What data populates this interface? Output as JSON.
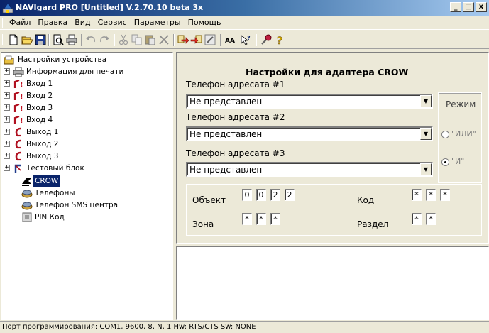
{
  "window": {
    "title": "NAVIgard PRO [Untitled]  V.2.70.10 beta 3x",
    "minimize": "_",
    "maximize": "□",
    "close": "x"
  },
  "menu": [
    "Файл",
    "Правка",
    "Вид",
    "Сервис",
    "Параметры",
    "Помощь"
  ],
  "toolbar_icons": [
    "new-icon",
    "open-icon",
    "save-icon",
    "print-preview-icon",
    "print-icon",
    "undo-icon",
    "redo-icon",
    "cut-icon",
    "copy-icon",
    "paste-icon",
    "delete-icon",
    "import-icon",
    "export-icon",
    "edit-icon",
    "font-icon",
    "cursor-help-icon",
    "tool-icon",
    "help-icon"
  ],
  "tree": {
    "root": "Настройки устройства",
    "items": [
      {
        "label": "Информация для печати",
        "icon": "printer-icon"
      },
      {
        "label": "Вход 1",
        "icon": "input-icon"
      },
      {
        "label": "Вход 2",
        "icon": "input-icon"
      },
      {
        "label": "Вход 3",
        "icon": "input-icon"
      },
      {
        "label": "Вход 4",
        "icon": "input-icon"
      },
      {
        "label": "Выход 1",
        "icon": "output-icon"
      },
      {
        "label": "Выход 2",
        "icon": "output-icon"
      },
      {
        "label": "Выход 3",
        "icon": "output-icon"
      },
      {
        "label": "Тестовый блок",
        "icon": "test-block-icon"
      }
    ],
    "children": [
      {
        "label": "CROW",
        "icon": "crow-icon",
        "selected": true
      },
      {
        "label": "Телефоны",
        "icon": "phone-icon"
      },
      {
        "label": "Телефон SMS центра",
        "icon": "phone-icon"
      },
      {
        "label": "PIN Код",
        "icon": "pin-icon"
      }
    ]
  },
  "panel": {
    "title": "Настройки для адаптера CROW",
    "phones": [
      {
        "label": "Телефон адресата #1",
        "value": "Не представлен"
      },
      {
        "label": "Телефон адресата #2",
        "value": "Не представлен"
      },
      {
        "label": "Телефон адресата #3",
        "value": "Не представлен"
      }
    ],
    "mode": {
      "title": "Режим",
      "options": [
        {
          "label": "\"ИЛИ\"",
          "checked": false
        },
        {
          "label": "\"И\"",
          "checked": true
        }
      ]
    },
    "object": {
      "label": "Объект",
      "digits": [
        "0",
        "0",
        "2",
        "2"
      ]
    },
    "code": {
      "label": "Код",
      "digits": [
        "*",
        "*",
        "*"
      ]
    },
    "zone": {
      "label": "Зона",
      "digits": [
        "*",
        "*",
        "*"
      ]
    },
    "section": {
      "label": "Раздел",
      "digits": [
        "*",
        "*"
      ]
    }
  },
  "status": "Порт программирования: COM1, 9600, 8, N, 1   Hw: RTS/CTS  Sw: NONE",
  "colors": {
    "selection": "#0a246a",
    "title_start": "#0a246a",
    "title_end": "#a6caf0",
    "face": "#ece9d8"
  }
}
